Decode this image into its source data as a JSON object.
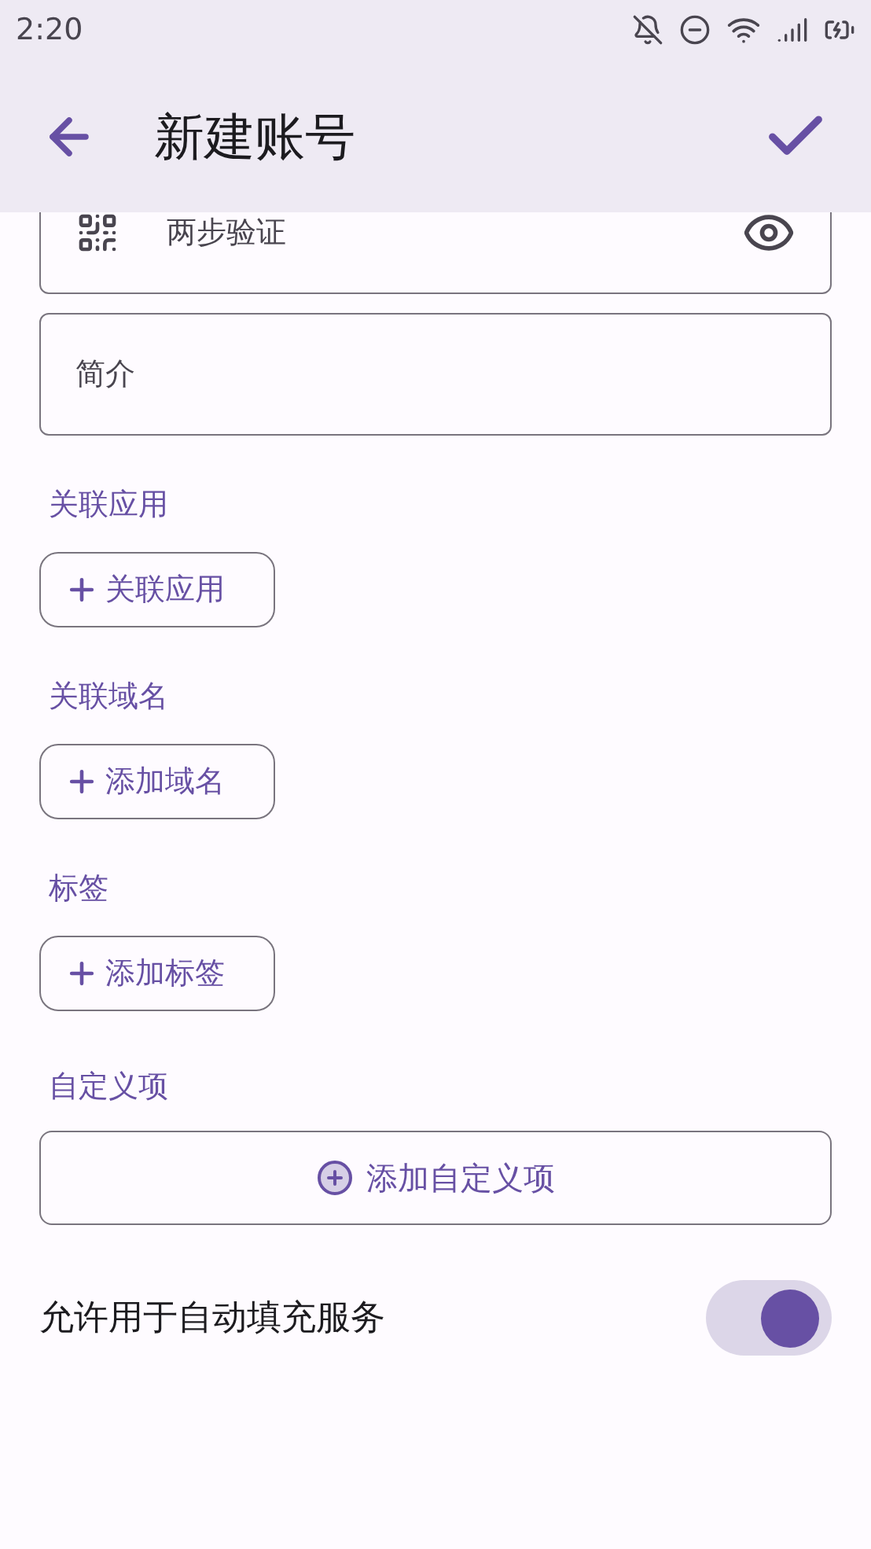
{
  "status_bar": {
    "time": "2:20"
  },
  "app_bar": {
    "title": "新建账号"
  },
  "fields": [
    {
      "kind": "otp",
      "placeholder": "两步验证"
    },
    {
      "kind": "text",
      "placeholder": "简介"
    }
  ],
  "sections": [
    {
      "label": "关联应用",
      "button": "关联应用"
    },
    {
      "label": "关联域名",
      "button": "添加域名"
    },
    {
      "label": "标签",
      "button": "添加标签"
    }
  ],
  "custom": {
    "label": "自定义项",
    "button": "添加自定义项"
  },
  "autofill": {
    "label": "允许用于自动填充服务",
    "on": true
  }
}
